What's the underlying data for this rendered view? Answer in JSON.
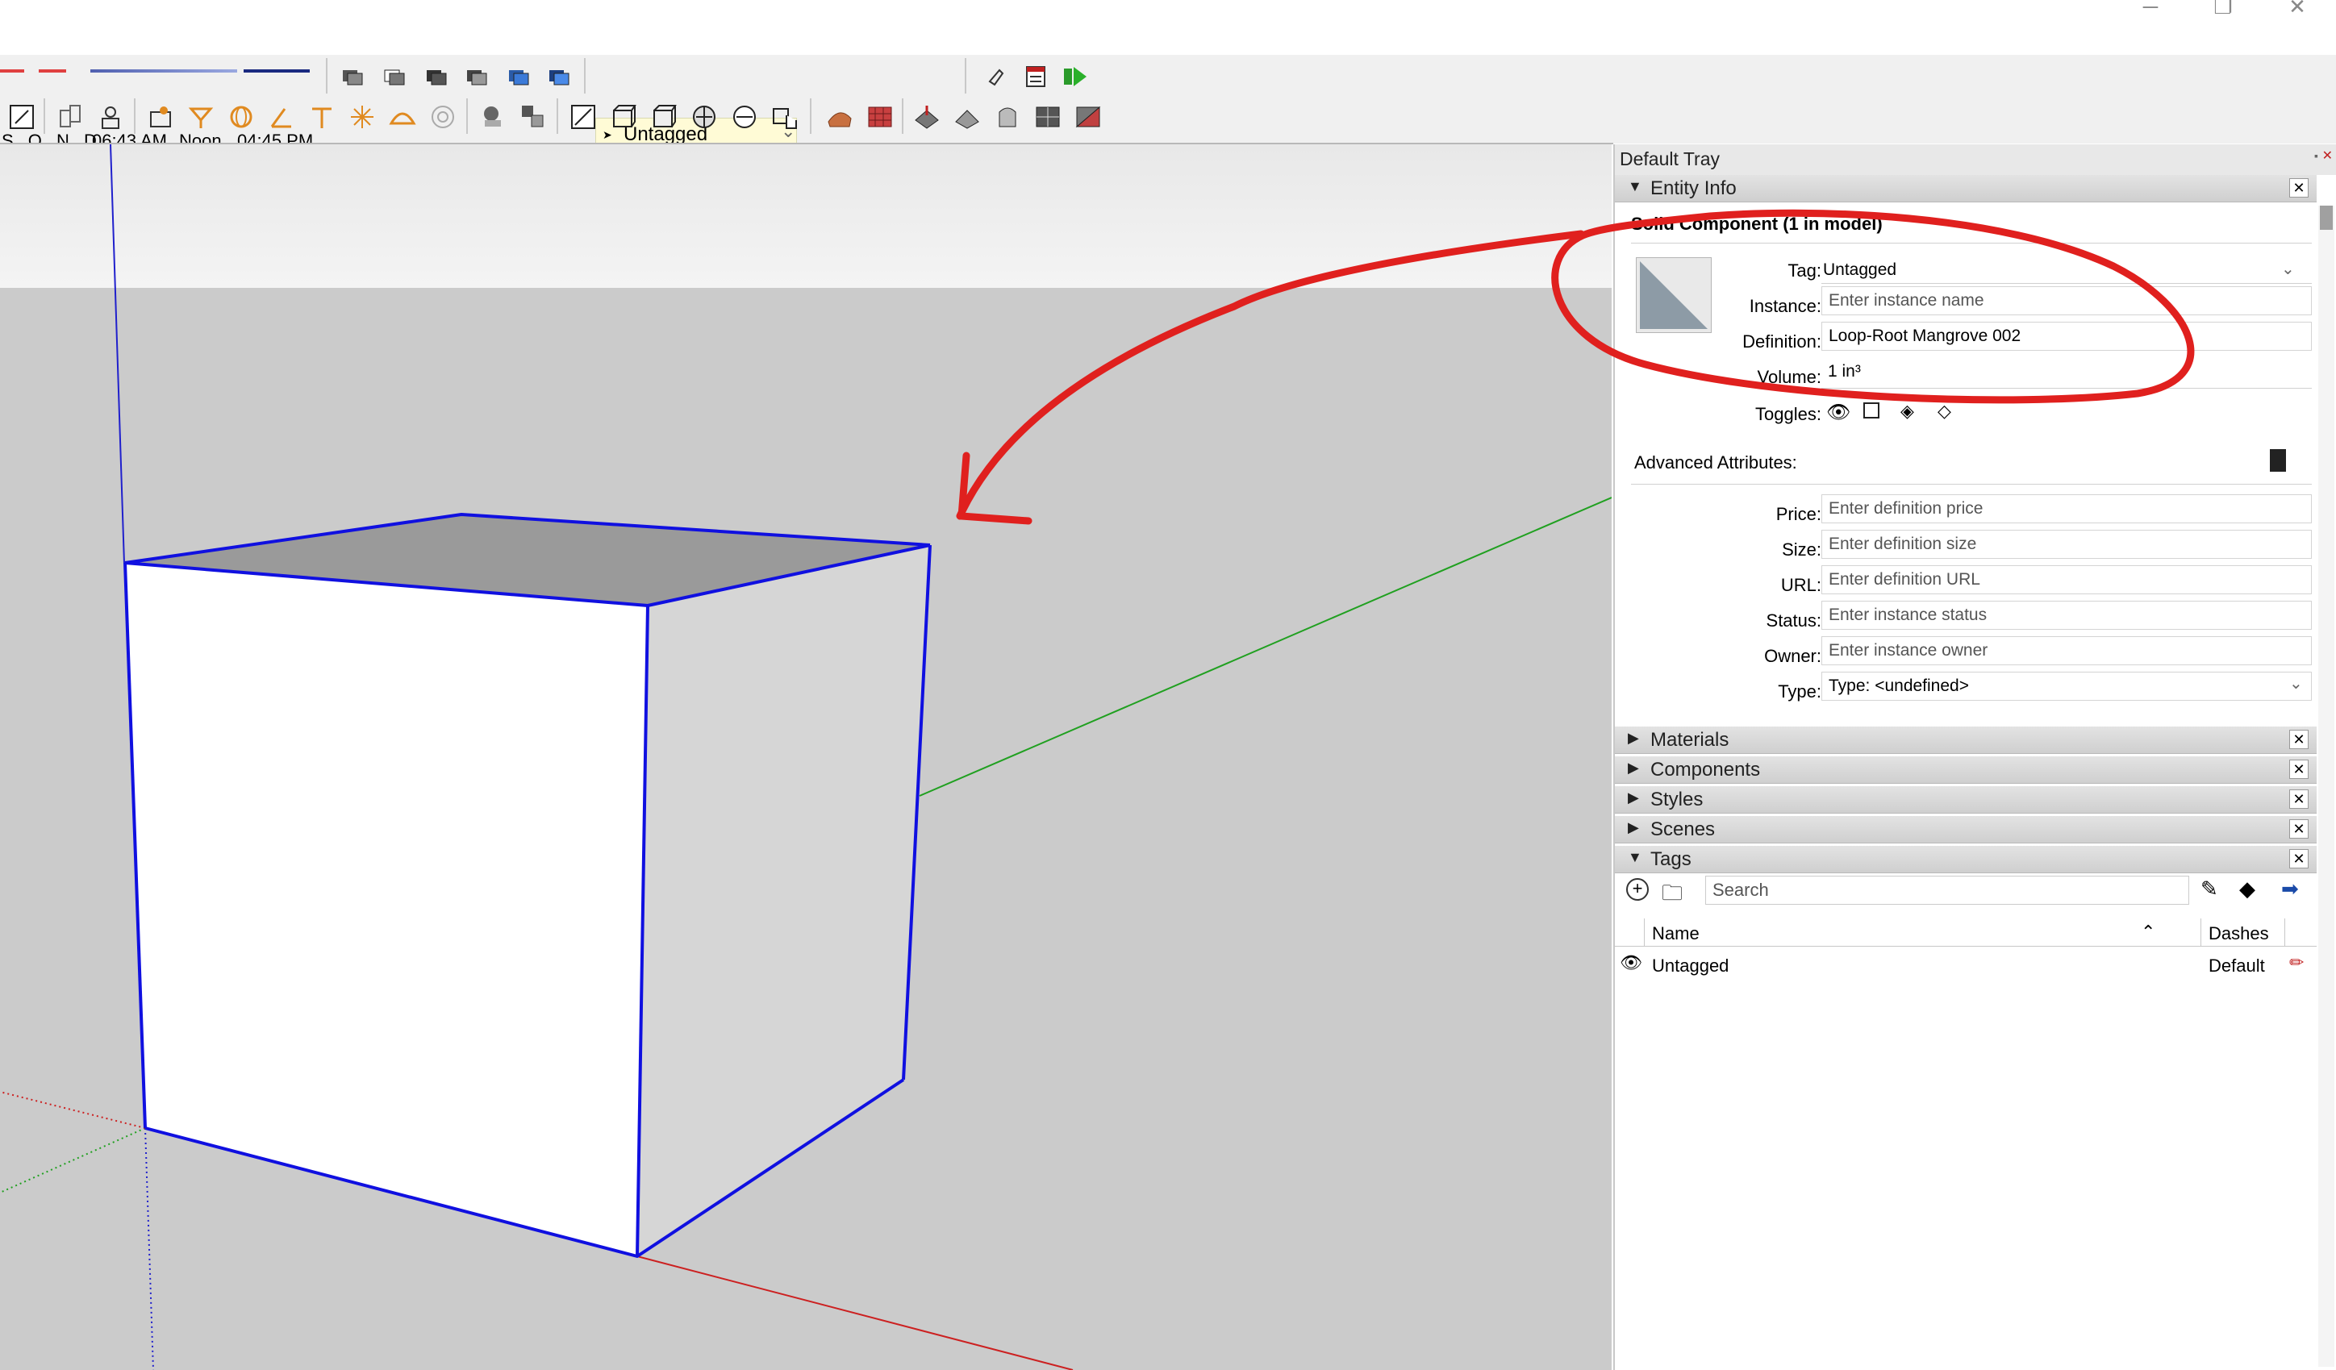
{
  "toolbar": {
    "shadow_months": "S O N D",
    "time_start": "06:43 AM",
    "time_mid": "Noon",
    "time_end": "04:45 PM",
    "active_tag": "Untagged"
  },
  "tray": {
    "title": "Default Tray",
    "panels": {
      "entity_info": "Entity Info",
      "materials": "Materials",
      "components": "Components",
      "styles": "Styles",
      "scenes": "Scenes",
      "tags": "Tags"
    }
  },
  "entity_info": {
    "heading": "Solid Component (1 in model)",
    "tag_label": "Tag:",
    "tag_value": "Untagged",
    "instance_label": "Instance:",
    "instance_placeholder": "Enter instance name",
    "definition_label": "Definition:",
    "definition_value": "Loop-Root Mangrove 002",
    "volume_label": "Volume:",
    "volume_value": "1 in³",
    "toggles_label": "Toggles:",
    "advanced_label": "Advanced Attributes:",
    "price_label": "Price:",
    "price_placeholder": "Enter definition price",
    "size_label": "Size:",
    "size_placeholder": "Enter definition size",
    "url_label": "URL:",
    "url_placeholder": "Enter definition URL",
    "status_label": "Status:",
    "status_placeholder": "Enter instance status",
    "owner_label": "Owner:",
    "owner_placeholder": "Enter instance owner",
    "type_label": "Type:",
    "type_value": "Type: <undefined>"
  },
  "tags_panel": {
    "search_placeholder": "Search",
    "col_name": "Name",
    "col_dashes": "Dashes",
    "rows": [
      {
        "name": "Untagged",
        "dashes": "Default"
      }
    ]
  },
  "colors": {
    "annotation": "#e0201e",
    "selection": "#1010e0",
    "x_axis": "#cc2020",
    "y_axis": "#20a020",
    "z_axis": "#2020cc"
  }
}
